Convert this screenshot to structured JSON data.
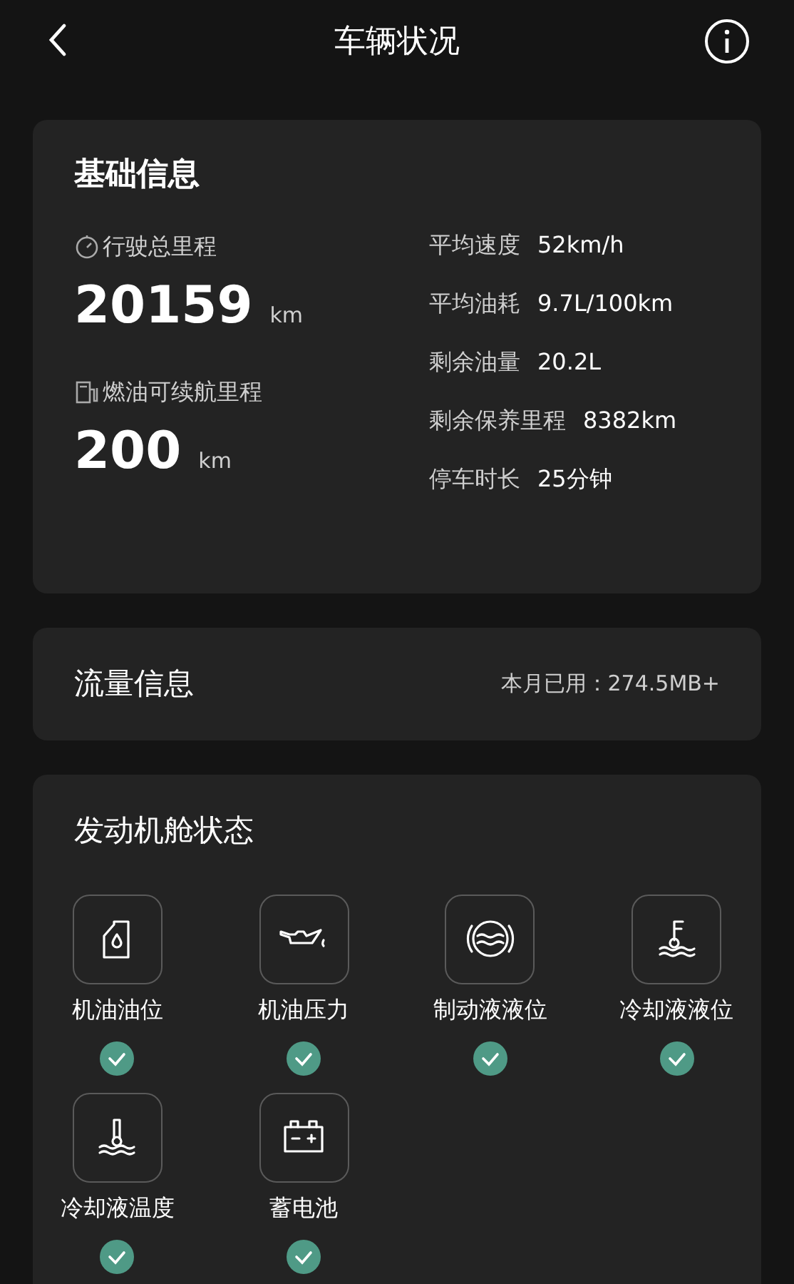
{
  "header": {
    "title": "车辆状况"
  },
  "basic_info": {
    "title": "基础信息",
    "primary": [
      {
        "kind": "odometer",
        "label": "行驶总里程",
        "value": "20159",
        "unit": "km"
      },
      {
        "kind": "fuel",
        "label": "燃油可续航里程",
        "value": "200",
        "unit": "km"
      }
    ],
    "stats": [
      {
        "label": "平均速度",
        "value": "52km/h"
      },
      {
        "label": "平均油耗",
        "value": "9.7L/100km"
      },
      {
        "label": "剩余油量",
        "value": "20.2L"
      },
      {
        "label": "剩余保养里程",
        "value": "8382km"
      },
      {
        "label": "停车时长",
        "value": "25分钟"
      }
    ]
  },
  "data_usage": {
    "title": "流量信息",
    "value": "本月已用：274.5MB+"
  },
  "engine_bay": {
    "title": "发动机舱状态",
    "items": [
      {
        "kind": "oil-can",
        "label": "机油油位",
        "ok": true
      },
      {
        "kind": "oil-pressure",
        "label": "机油压力",
        "ok": true
      },
      {
        "kind": "brake-fluid",
        "label": "制动液液位",
        "ok": true
      },
      {
        "kind": "coolant-level",
        "label": "冷却液液位",
        "ok": true
      },
      {
        "kind": "coolant-temp",
        "label": "冷却液温度",
        "ok": true
      },
      {
        "kind": "battery",
        "label": "蓄电池",
        "ok": true
      }
    ]
  }
}
